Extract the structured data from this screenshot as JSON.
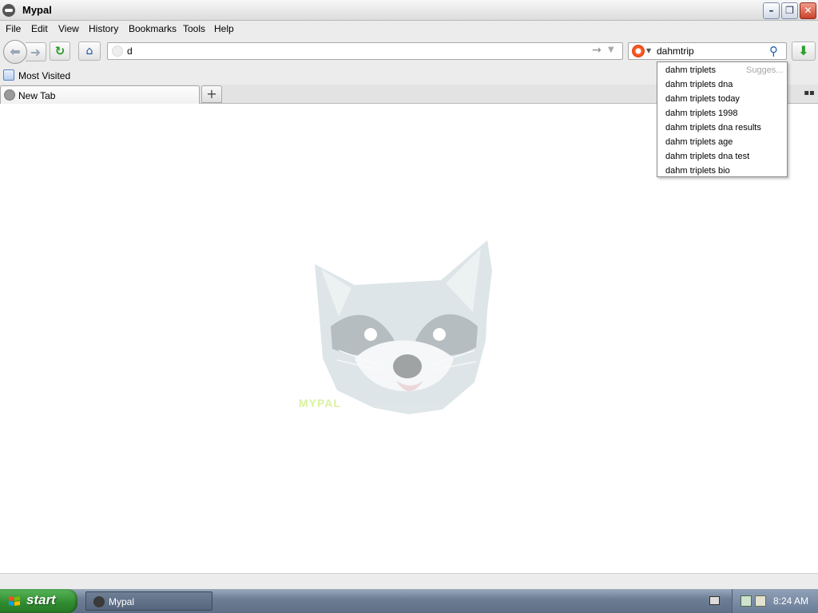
{
  "window": {
    "title": "Mypal"
  },
  "menubar": [
    "File",
    "Edit",
    "View",
    "History",
    "Bookmarks",
    "Tools",
    "Help"
  ],
  "urlbar": {
    "value": "d"
  },
  "searchbar": {
    "value": "dahmtrip"
  },
  "bookmarks": {
    "most_visited": "Most Visited"
  },
  "tabs": [
    {
      "label": "New Tab"
    }
  ],
  "suggestions": {
    "hint": "Sugges...",
    "items": [
      "dahm triplets",
      "dahm triplets dna",
      "dahm triplets today",
      "dahm triplets 1998",
      "dahm triplets dna results",
      "dahm triplets age",
      "dahm triplets dna test",
      "dahm triplets bio"
    ]
  },
  "content": {
    "logo_caption": "MYPAL"
  },
  "taskbar": {
    "start_label": "start",
    "window_label": "Mypal",
    "clock": "8:24 AM"
  },
  "colors": {
    "start_green": "#2f8a2f",
    "taskbar_blue": "#6e7e95"
  }
}
